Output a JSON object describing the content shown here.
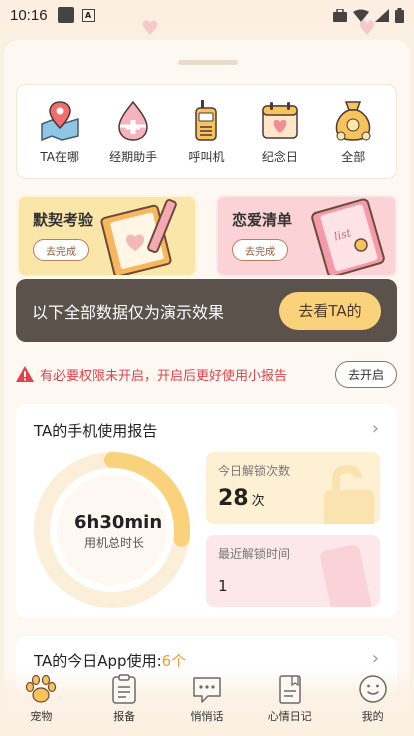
{
  "status_bar": {
    "time": "10:16"
  },
  "features": [
    {
      "label": "TA在哪",
      "icon": "map-pin-icon"
    },
    {
      "label": "经期助手",
      "icon": "drop-plus-icon"
    },
    {
      "label": "呼叫机",
      "icon": "walkie-talkie-icon"
    },
    {
      "label": "纪念日",
      "icon": "calendar-heart-icon"
    },
    {
      "label": "全部",
      "icon": "money-bag-icon"
    }
  ],
  "promos": [
    {
      "title": "默契考验",
      "button": "去完成",
      "color": "#fbe6aa"
    },
    {
      "title": "恋爱清单",
      "button": "去完成",
      "color": "#fbd3d7"
    }
  ],
  "demo_banner": {
    "text": "以下全部数据仅为演示效果",
    "button": "去看TA的"
  },
  "warning": {
    "text": "有必要权限未开启，开启后更好使用小报告",
    "button": "去开启"
  },
  "report": {
    "title": "TA的手机使用报告",
    "usage_value": "6h30min",
    "usage_label": "用机总时长",
    "usage_fraction": 0.27,
    "unlock_label": "今日解锁次数",
    "unlock_value": "28",
    "unlock_unit": "次",
    "recent_label": "最近解锁时间",
    "recent_value": "1"
  },
  "app_usage": {
    "title": "TA的今日App使用:",
    "count": "6个"
  },
  "tabs": [
    {
      "label": "宠物",
      "icon": "paw-icon"
    },
    {
      "label": "报备",
      "icon": "clipboard-icon"
    },
    {
      "label": "悄悄话",
      "icon": "chat-bubble-icon"
    },
    {
      "label": "心情日记",
      "icon": "diary-icon"
    },
    {
      "label": "我的",
      "icon": "smiley-icon"
    }
  ],
  "colors": {
    "accent": "#fbd27c",
    "warning": "#e0414c",
    "banner": "#5a524b",
    "ring": "#fbd27c"
  }
}
